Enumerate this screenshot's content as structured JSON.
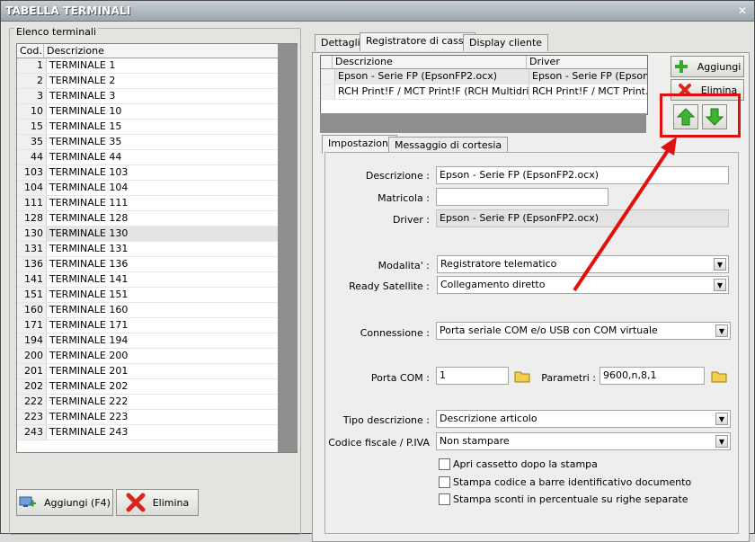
{
  "window": {
    "title": "TABELLA TERMINALI",
    "close_glyph": "✕"
  },
  "left": {
    "group_label": "Elenco terminali",
    "columns": [
      "Cod.",
      "Descrizione"
    ],
    "rows": [
      {
        "cod": "1",
        "desc": "TERMINALE 1"
      },
      {
        "cod": "2",
        "desc": "TERMINALE 2"
      },
      {
        "cod": "3",
        "desc": "TERMINALE 3"
      },
      {
        "cod": "10",
        "desc": "TERMINALE 10"
      },
      {
        "cod": "15",
        "desc": "TERMINALE 15"
      },
      {
        "cod": "35",
        "desc": "TERMINALE 35"
      },
      {
        "cod": "44",
        "desc": "TERMINALE 44"
      },
      {
        "cod": "103",
        "desc": "TERMINALE 103"
      },
      {
        "cod": "104",
        "desc": "TERMINALE 104"
      },
      {
        "cod": "111",
        "desc": "TERMINALE 111"
      },
      {
        "cod": "128",
        "desc": "TERMINALE 128"
      },
      {
        "cod": "130",
        "desc": "TERMINALE 130"
      },
      {
        "cod": "131",
        "desc": "TERMINALE 131"
      },
      {
        "cod": "136",
        "desc": "TERMINALE 136"
      },
      {
        "cod": "141",
        "desc": "TERMINALE 141"
      },
      {
        "cod": "151",
        "desc": "TERMINALE 151"
      },
      {
        "cod": "160",
        "desc": "TERMINALE 160"
      },
      {
        "cod": "171",
        "desc": "TERMINALE 171"
      },
      {
        "cod": "194",
        "desc": "TERMINALE 194"
      },
      {
        "cod": "200",
        "desc": "TERMINALE 200"
      },
      {
        "cod": "201",
        "desc": "TERMINALE 201"
      },
      {
        "cod": "202",
        "desc": "TERMINALE 202"
      },
      {
        "cod": "222",
        "desc": "TERMINALE 222"
      },
      {
        "cod": "223",
        "desc": "TERMINALE 223"
      },
      {
        "cod": "243",
        "desc": "TERMINALE 243"
      }
    ],
    "selected_cod": "130",
    "add_button": "Aggiungi (F4)",
    "delete_button": "Elimina"
  },
  "tabs": {
    "t1": "Dettagli",
    "t2": "Registratore di cassa",
    "t3": "Display cliente",
    "active": "Registratore di cassa"
  },
  "drivers": {
    "columns": [
      "Descrizione",
      "Driver"
    ],
    "rows": [
      {
        "desc": "Epson - Serie FP (EpsonFP2.ocx)",
        "driver": "Epson - Serie FP (Epson..."
      },
      {
        "desc": "RCH Print!F / MCT Print!F (RCH Multidriver)",
        "driver": "RCH Print!F / MCT Print..."
      }
    ],
    "add_button": "Aggiungi",
    "delete_button": "Elimina"
  },
  "inner_tabs": {
    "t1": "Impostazioni",
    "t2": "Messaggio di cortesia"
  },
  "form": {
    "descrizione_label": "Descrizione :",
    "descrizione_value": "Epson - Serie FP (EpsonFP2.ocx)",
    "matricola_label": "Matricola :",
    "matricola_value": "",
    "driver_label": "Driver :",
    "driver_value": "Epson - Serie FP (EpsonFP2.ocx)",
    "modalita_label": "Modalita' :",
    "modalita_value": "Registratore telematico",
    "ready_label": "Ready Satellite :",
    "ready_value": "Collegamento diretto",
    "connessione_label": "Connessione :",
    "connessione_value": "Porta seriale COM e/o USB con COM virtuale",
    "porta_label": "Porta COM :",
    "porta_value": "1",
    "parametri_label": "Parametri :",
    "parametri_value": "9600,n,8,1",
    "tipo_label": "Tipo descrizione :",
    "tipo_value": "Descrizione articolo",
    "cf_label": "Codice fiscale / P.IVA",
    "cf_value": "Non stampare",
    "check1": "Apri cassetto dopo la stampa",
    "check2": "Stampa codice a barre identificativo documento",
    "check3": "Stampa sconti in percentuale su righe separate"
  },
  "colors": {
    "annotation_red": "#e01010",
    "move_arrow_green": "#39b12d"
  }
}
